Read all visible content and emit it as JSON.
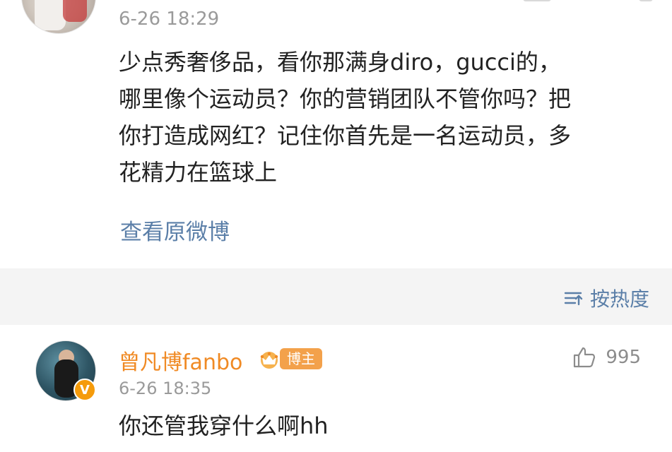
{
  "top_comment": {
    "time": "6-26 18:29",
    "text_lines": [
      "少点秀奢侈品，看你那满身diro，gucci的，",
      "哪里像个运动员？你的营销团队不管你吗？把",
      "你打造成网红？记住你首先是一名运动员，多",
      "花精力在篮球上"
    ],
    "view_original_label": "查看原微博"
  },
  "sort": {
    "label": "按热度",
    "icon": "sort-icon"
  },
  "reply": {
    "name": "曾凡博fanbo",
    "badge_label": "博主",
    "time": "6-26 18:35",
    "text": "你还管我穿什么啊hh",
    "like_count": "995",
    "verified_badge": "V"
  },
  "colors": {
    "link_blue": "#5b7fa8",
    "name_orange": "#f08a24",
    "meta_grey": "#9a9a9a",
    "band_grey": "#f4f4f4"
  }
}
